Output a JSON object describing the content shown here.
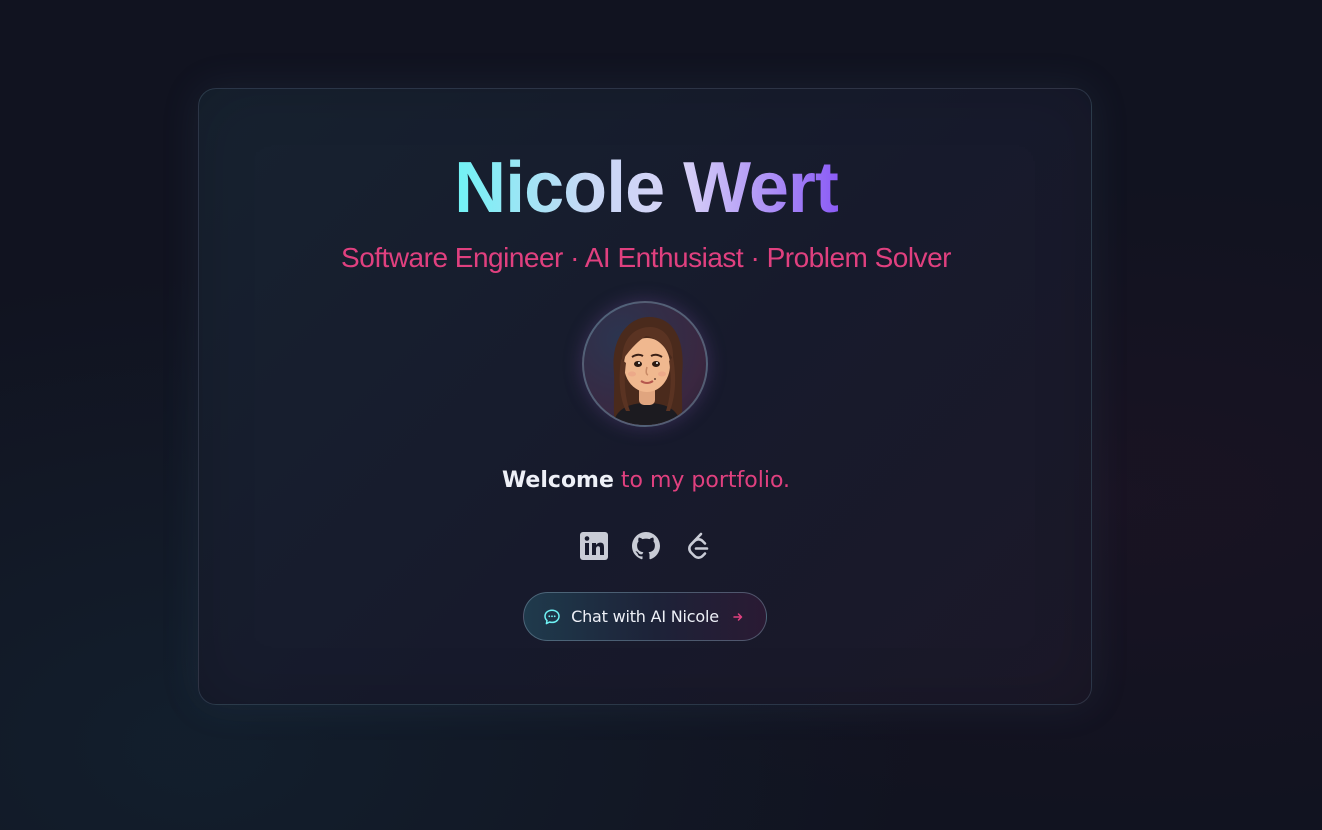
{
  "profile": {
    "name": "Nicole Wert",
    "tagline": "Software Engineer · AI Enthusiast · Problem Solver",
    "welcome_strong": "Welcome",
    "welcome_rest": "to my portfolio."
  },
  "social_links": [
    {
      "icon": "linkedin-icon"
    },
    {
      "icon": "github-icon"
    },
    {
      "icon": "leetcode-icon"
    }
  ],
  "chat_button": {
    "label": "Chat with AI Nicole",
    "icon": "chat-bubble-icon",
    "trailing_icon": "arrow-right-icon"
  },
  "colors": {
    "background": "#111320",
    "accent_pink": "#e0407f",
    "title_gradient_start": "#6ff3f5",
    "title_gradient_end": "#8b5cf6",
    "icon_gray": "#c9ccd6"
  }
}
